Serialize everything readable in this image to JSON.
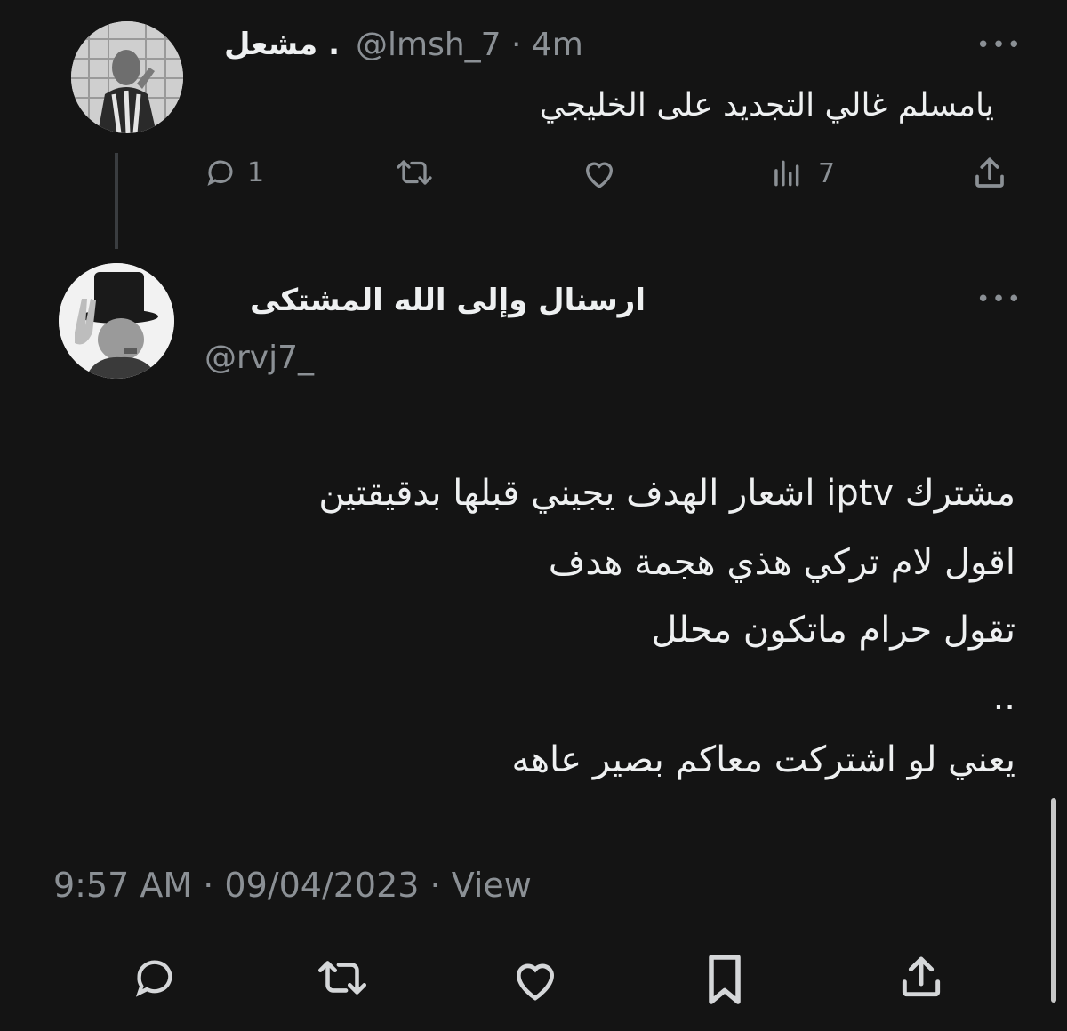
{
  "reply_tweet": {
    "display_name": "مشعل .",
    "handle": "@lmsh_7",
    "separator": "·",
    "time_ago": "4m",
    "text": "يامسلم غالي التجديد على الخليجي",
    "actions": {
      "reply_count": "1",
      "retweet_count": "",
      "like_count": "",
      "views_count": "7"
    },
    "more_label": "•••"
  },
  "main_tweet": {
    "display_name": "ارسنال وإلى الله المشتكى",
    "handle": "@rvj7_",
    "more_label": "•••",
    "lines": [
      "مشترك iptv اشعار الهدف يجيني قبلها بدقيقتين",
      "اقول لام تركي هذي هجمة هدف",
      "تقول حرام ماتكون محلل",
      "..",
      "يعني لو اشتركت معاكم بصير عاهه"
    ],
    "timestamp": "9:57 AM · 09/04/2023 · View"
  },
  "icons": {
    "reply": "reply-bubble-icon",
    "retweet": "retweet-icon",
    "like": "heart-icon",
    "views": "views-bars-icon",
    "share": "share-icon",
    "bookmark": "bookmark-icon",
    "more": "more-dots-icon"
  },
  "colors": {
    "background": "#141414",
    "text": "#eef0f1",
    "muted": "#8b9095"
  }
}
